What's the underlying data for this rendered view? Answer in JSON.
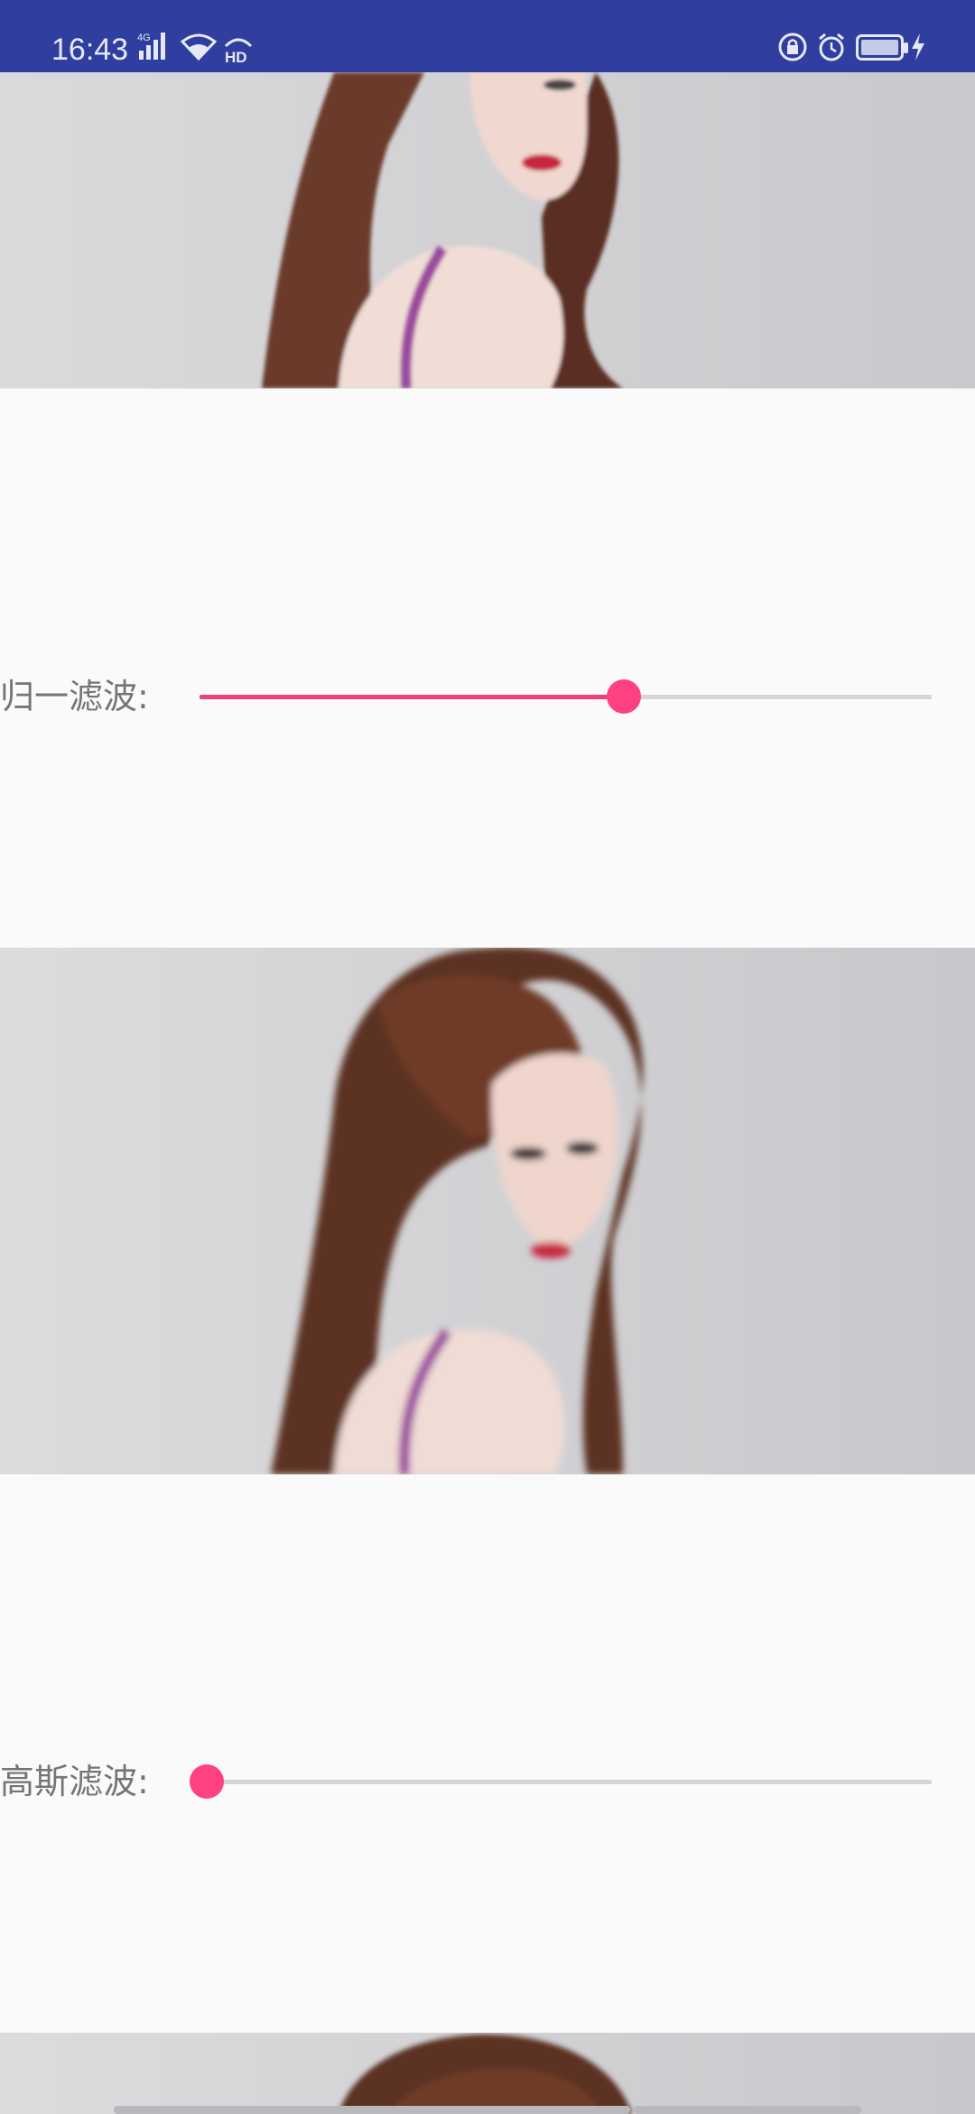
{
  "status_bar": {
    "time": "16:43",
    "network_label": "4G",
    "hd_label": "HD",
    "icons": [
      "signal-icon",
      "wifi-icon",
      "hd-icon",
      "screen-lock-rotation-icon",
      "alarm-icon",
      "battery-icon",
      "charging-icon"
    ],
    "background_color": "#303f9f"
  },
  "filters": [
    {
      "label": "归一滤波:",
      "progress_fraction": 0.58,
      "progress_color": "#ec407a",
      "thumb_color": "#ff4081"
    },
    {
      "label": "高斯滤波:",
      "progress_fraction": 0.01,
      "progress_color": "#ec407a",
      "thumb_color": "#ff4081"
    }
  ],
  "photos": [
    {
      "subject": "woman-portrait",
      "blur": "cropped-top"
    },
    {
      "subject": "woman-portrait",
      "blur": "box-filtered"
    },
    {
      "subject": "woman-portrait",
      "blur": "partially-visible"
    }
  ],
  "colors": {
    "page_background": "#fafafa",
    "label_text": "#757575",
    "track": "#d6d6d6"
  }
}
